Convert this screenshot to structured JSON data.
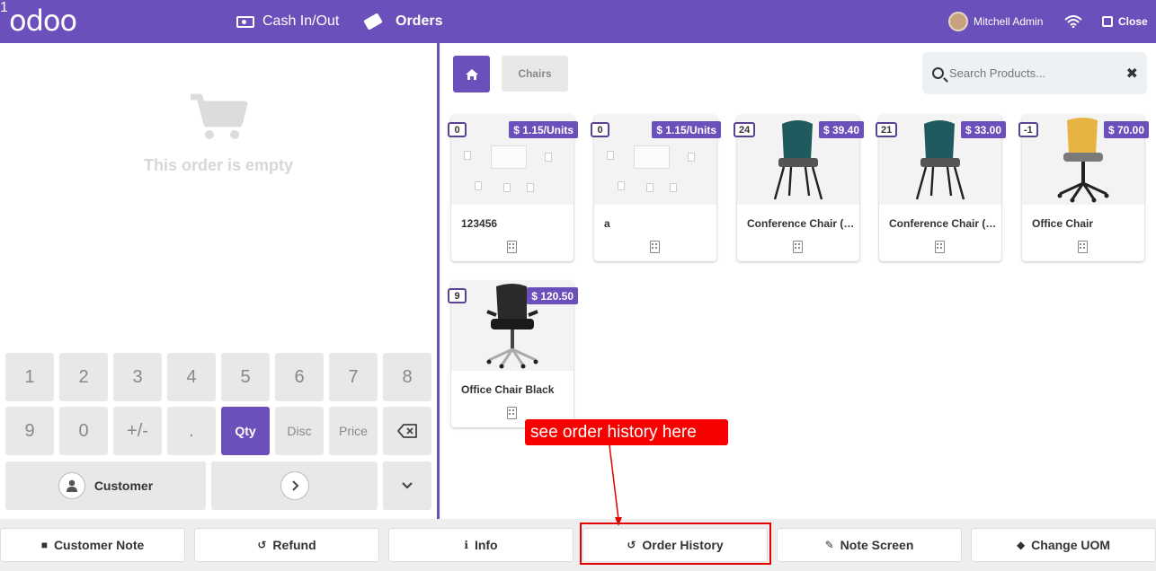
{
  "topbar": {
    "logo": "odoo",
    "cash_in_out": "Cash In/Out",
    "orders": "Orders",
    "orders_badge": "1",
    "user": "Mitchell Admin",
    "close": "Close",
    "icons": [
      "cash-icon",
      "ticket-icon",
      "wifi-icon",
      "sign-out-icon"
    ]
  },
  "order": {
    "empty_text": "This order is empty"
  },
  "numpad": {
    "row1": [
      "1",
      "2",
      "3",
      "4",
      "5",
      "6",
      "7",
      "8"
    ],
    "row2": [
      "9",
      "0",
      "+/-",
      ".",
      "Qty",
      "Disc",
      "Price"
    ],
    "active": "Qty",
    "customer": "Customer"
  },
  "products_panel": {
    "category": "Chairs",
    "search_placeholder": "Search Products...",
    "products": [
      {
        "name": "123456",
        "price": "$ 1.15/Units",
        "qty": "0"
      },
      {
        "name": "a",
        "price": "$ 1.15/Units",
        "qty": "0"
      },
      {
        "name": "Conference Chair (Steel)",
        "price": "$ 39.40",
        "qty": "24"
      },
      {
        "name": "Conference Chair (Aluminium)",
        "price": "$ 33.00",
        "qty": "21"
      },
      {
        "name": "Office Chair",
        "price": "$ 70.00",
        "qty": "-1"
      },
      {
        "name": "Office Chair Black",
        "price": "$ 120.50",
        "qty": "9"
      }
    ]
  },
  "actions": [
    {
      "label": "Customer Note",
      "icon": "sticky-note-icon"
    },
    {
      "label": "Refund",
      "icon": "undo-icon"
    },
    {
      "label": "Info",
      "icon": "info-icon"
    },
    {
      "label": "Order History",
      "icon": "history-icon"
    },
    {
      "label": "Note Screen",
      "icon": "edit-icon"
    },
    {
      "label": "Change UOM",
      "icon": "tag-icon"
    }
  ],
  "annotation": {
    "text": "see order history  here",
    "color": "#f80000"
  },
  "colors": {
    "brand": "#6b4fbb",
    "highlight": "#e30000"
  }
}
